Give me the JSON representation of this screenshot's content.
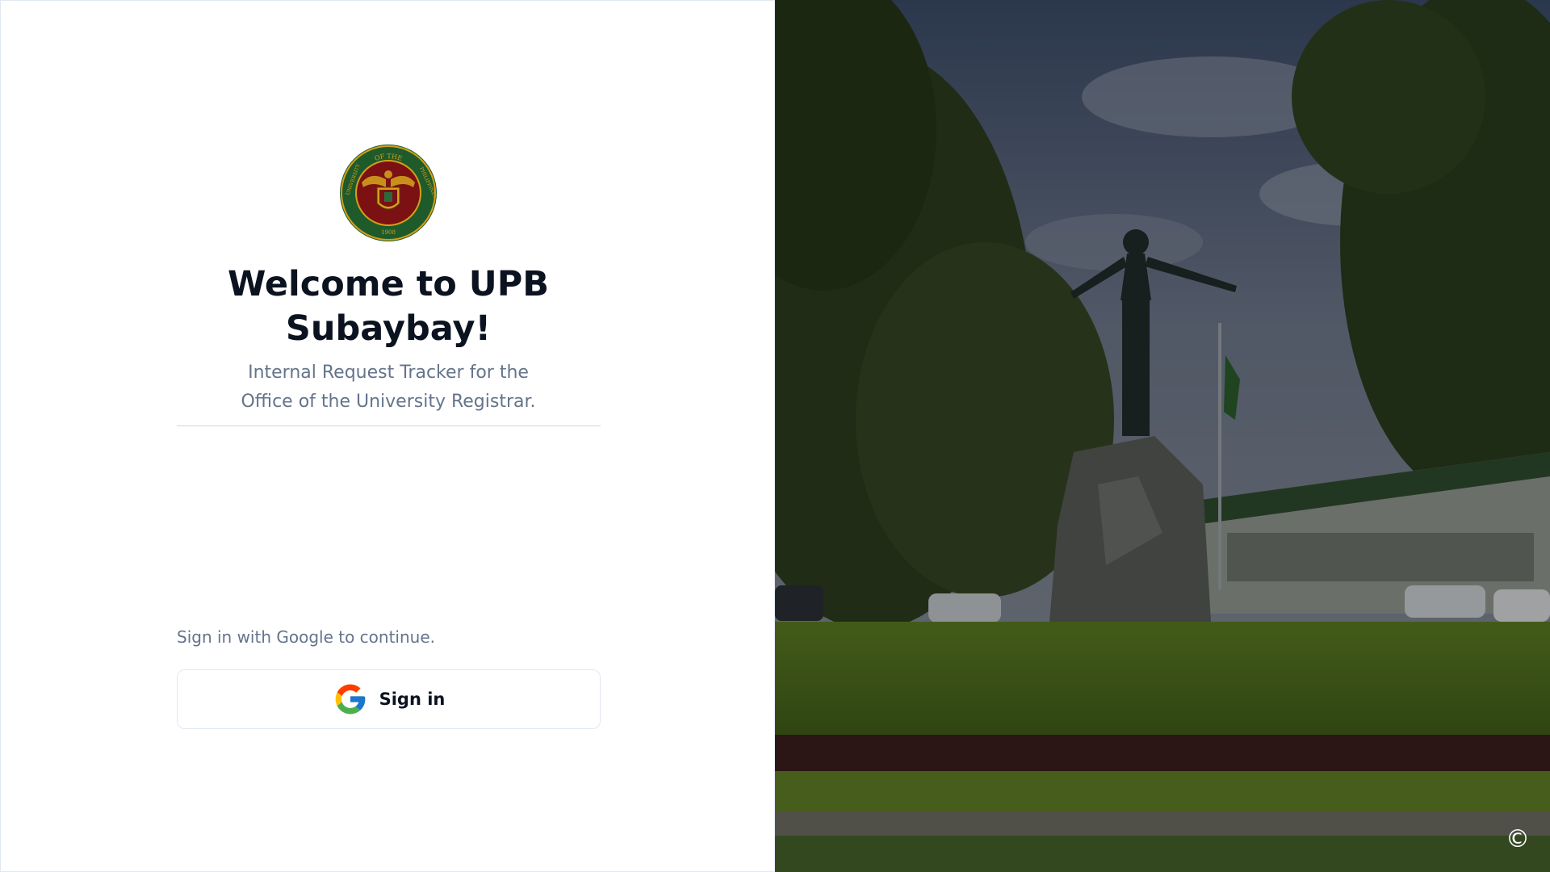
{
  "login": {
    "title": "Welcome to UPB Subaybay!",
    "subtitle_line1": "Internal Request Tracker for the",
    "subtitle_line2": "Office of the University Registrar.",
    "signin_hint": "Sign in with Google to continue.",
    "signin_button_label": "Sign in",
    "google_icon": "google-g-icon"
  },
  "logo": {
    "name": "university-of-the-philippines-seal",
    "text_top": "OF THE",
    "text_left": "UNIVERSITY",
    "text_right": "PHILIPPINES",
    "year": "1908"
  },
  "hero": {
    "description_icon": "copyright-icon",
    "copyright_symbol": "©"
  },
  "colors": {
    "title": "#0b1220",
    "muted": "#64748b",
    "divider": "#cbd5e1",
    "border": "#e2e8f0",
    "seal_green": "#1f5a2b",
    "seal_maroon": "#7b1113",
    "seal_gold": "#d4a017"
  }
}
